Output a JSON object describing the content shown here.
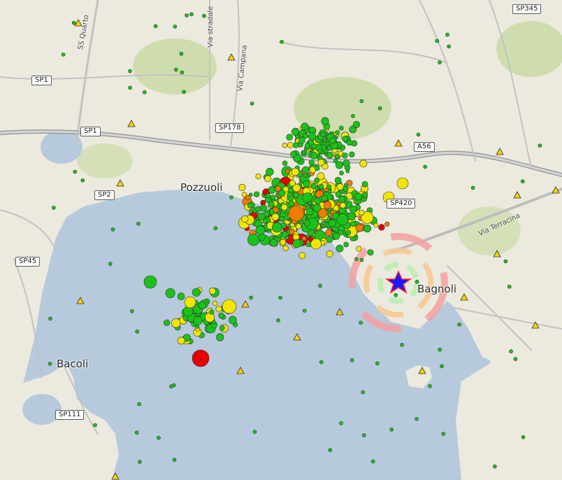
{
  "map": {
    "road_labels": [
      {
        "id": "sp345",
        "text": "SP345"
      },
      {
        "id": "sp1-north",
        "text": "SP1"
      },
      {
        "id": "sp1-south",
        "text": "SP1"
      },
      {
        "id": "sp178",
        "text": "SP178"
      },
      {
        "id": "a56",
        "text": "A56"
      },
      {
        "id": "sp2",
        "text": "SP2"
      },
      {
        "id": "sp420",
        "text": "SP420"
      },
      {
        "id": "sp45",
        "text": "SP45"
      },
      {
        "id": "sp111",
        "text": "SP111"
      }
    ],
    "places": [
      {
        "id": "pozzuoli",
        "text": "Pozzuoli"
      },
      {
        "id": "bagnoli",
        "text": "Bagnoli"
      },
      {
        "id": "bacoli",
        "text": "Bacoli"
      }
    ],
    "streets": [
      {
        "id": "ss-quarto",
        "text": "SS Quarto"
      },
      {
        "id": "via-stradale",
        "text": "Via stradale"
      },
      {
        "id": "via-campana",
        "text": "Via Campana"
      },
      {
        "id": "via-terracina",
        "text": "Via Terracina"
      }
    ],
    "colors": {
      "sea": "#b7c9dc",
      "land": "#ece9df",
      "green_area": "#cfdcae",
      "road": "#ffffff",
      "motorway": "#a9a9a9",
      "quake_green": "#19c319",
      "quake_yellow": "#f2e600",
      "quake_orange": "#f07c00",
      "quake_red": "#e80000",
      "epicenter_star": "#1a1aff",
      "station_triangle": "#f7d300",
      "ring_pink": "#f5a0a0",
      "ring_orange": "#f7c890",
      "ring_green": "#b9f0b0"
    },
    "markers": {
      "epicenter": "star-icon",
      "station": "triangle-icon",
      "event": "circle-icon"
    }
  }
}
